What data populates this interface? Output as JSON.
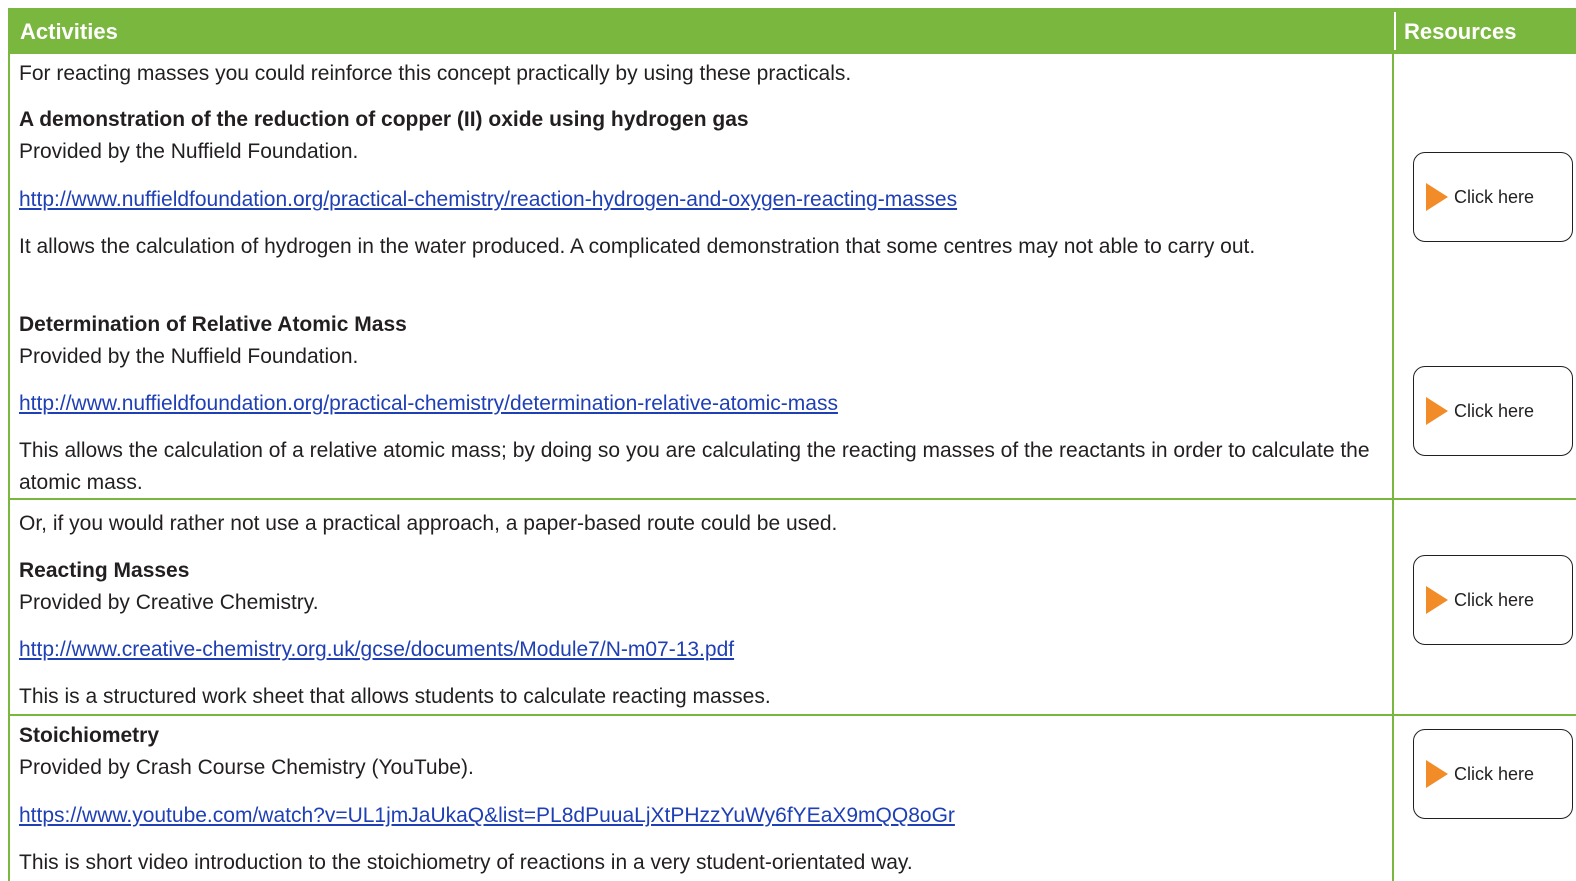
{
  "header": {
    "activities": "Activities",
    "resources": "Resources"
  },
  "colors": {
    "green": "#7ab73f",
    "orange": "#f28c28",
    "link": "#1f3fb5"
  },
  "section1": {
    "intro": "For reacting masses you could reinforce this concept practically by using these practicals.",
    "item1": {
      "title": "A demonstration of the reduction of copper (II) oxide using hydrogen gas",
      "provider": "Provided by the Nuffield Foundation.",
      "url": "http://www.nuffieldfoundation.org/practical-chemistry/reaction-hydrogen-and-oxygen-reacting-masses",
      "desc": "It allows the calculation of hydrogen in the water produced. A complicated demonstration that some centres may not able to carry out."
    },
    "item2": {
      "title": "Determination of Relative Atomic Mass",
      "provider": "Provided by the Nuffield Foundation.",
      "url": "http://www.nuffieldfoundation.org/practical-chemistry/determination-relative-atomic-mass",
      "desc": "This allows the calculation of a relative atomic mass; by doing so you are calculating the reacting masses of the reactants in order to calculate the atomic mass."
    }
  },
  "section2": {
    "intro": "Or, if you would rather not use a practical approach, a paper-based route could be used.",
    "title": "Reacting Masses",
    "provider": "Provided by Creative Chemistry.",
    "url": "http://www.creative-chemistry.org.uk/gcse/documents/Module7/N-m07-13.pdf",
    "desc": "This is a structured work sheet that allows students to calculate reacting masses."
  },
  "section3": {
    "title": "Stoichiometry",
    "provider": "Provided by Crash Course Chemistry (YouTube).",
    "url": "https://www.youtube.com/watch?v=UL1jmJaUkaQ&list=PL8dPuuaLjXtPHzzYuWy6fYEaX9mQQ8oGr",
    "desc": "This is short video introduction to the stoichiometry of reactions in a very student-orientated way."
  },
  "buttons": {
    "click_here": "Click here",
    "icon": "play-arrow-icon"
  }
}
